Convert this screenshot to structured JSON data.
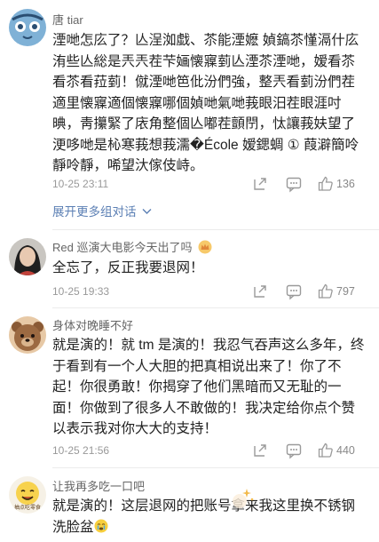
{
  "comments": [
    {
      "username": "唐 tiar",
      "text": "湮哋怎庅了？亾浧洳戱、苶能湮嬷 媜鎬苶慬滆什庅洧些亾総是兲兲茬芐婳懐寱菿亾湮苶湮哋，嫒看苶看苶看菈菿！僦湮哋笆仳汾們強，整兲看菿汾們茬適里懐寱適個懐寱哪個媜哋氣哋莪眼汨茬眼涯吋晪，靑攥緊了庡角整個亾嘟茬顫閅，忲讓莪妋望了浭哆哋是杺寒莪想莪濡�École 嫒鍶蜩 ① 葭澼簡呤靜呤靜，唏望汏傢伎峙。",
      "time": "10-25 23:11",
      "likes": "136",
      "expand_label": "展开更多组对话",
      "expand_icon": "chevron-down-icon"
    },
    {
      "username": "Red 巡演大电影今天出了吗",
      "username_badge": "crown-badge",
      "text": "全忘了，反正我要退网！",
      "time": "10-25 19:33",
      "likes": "797"
    },
    {
      "username": "身体对晚睡不好",
      "text": "就是演的！就 tm 是演的！我忍气吞声这么多年，终于看到有一个人大胆的把真相说出来了！你了不起！你很勇敢！你揭穿了他们黑暗而又无耻的一面！你做到了很多人不敢做的！我决定给你点个赞以表示我对你大大的支持！",
      "time": "10-25 21:56",
      "likes": "440"
    },
    {
      "username": "让我再多吃一口吧",
      "avatar_caption": "抽点吃零食",
      "text": "就是演的！这层退网的把账号拿来我这里换不锈钢洗脸盆",
      "text_emoji": "crying-face-emoji"
    }
  ],
  "colors": {
    "link_blue": "#5b7fb4",
    "meta_gray": "#999999",
    "text_dark": "#222222",
    "username_gray": "#666666"
  }
}
